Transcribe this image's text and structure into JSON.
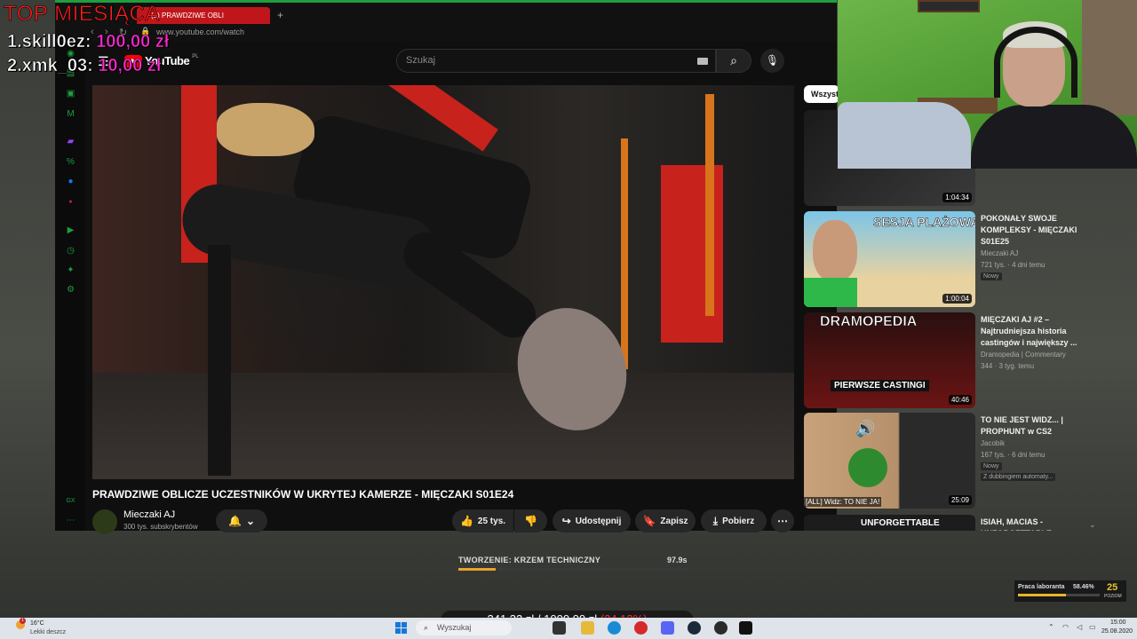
{
  "browser": {
    "tab_title": "(1) PRAWDZIWE OBLI",
    "new_tab": "+",
    "url": "www.youtube.com/watch",
    "accent": "#1e9e3e"
  },
  "youtube": {
    "logo_text": "YouTube",
    "region": "PL",
    "search_placeholder": "Szukaj",
    "search_icon": "search-icon",
    "mic_icon": "mic-icon"
  },
  "video": {
    "title": "PRAWDZIWE OBLICZE UCZESTNIKÓW W UKRYTEJ KAMERZE - MIĘCZAKI S01E24",
    "channel": "Mieczaki AJ",
    "subscribers": "300 tys. subskrybentów",
    "likes": "25 tys.",
    "share": "Udostępnij",
    "save": "Zapisz",
    "download": "Pobierz"
  },
  "recommendations": {
    "filter": "Wszystko",
    "items": [
      {
        "title": "",
        "channel": "",
        "views": "",
        "age": "",
        "duration": "1:04:34",
        "badge": ""
      },
      {
        "title": "POKONAŁY SWOJE KOMPLEKSY - MIĘCZAKI S01E25",
        "channel": "Mieczaki AJ",
        "views": "721 tys.",
        "age": "4 dni temu",
        "duration": "1:00:04",
        "badge": "Nowy",
        "thumb_text": "SESJA PLAŻOWA"
      },
      {
        "title": "MIĘCZAKI AJ #2 – Najtrudniejsza historia castingów i największy ...",
        "channel": "Dramopedia | Commentary",
        "views": "344",
        "age": "3 tyg. temu",
        "duration": "40:46",
        "badge": "",
        "thumb_text": "DRAMOPEDIA",
        "thumb_text2": "PIERWSZE CASTINGI"
      },
      {
        "title": "TO NIE JEST WIDZ... | PROPHUNT w CS2",
        "channel": "Jacobik",
        "views": "167 tys.",
        "age": "6 dni temu",
        "duration": "25:09",
        "badge": "Nowy",
        "badge2": "Z dubbingiem automaty...",
        "thumb_text": "[ALL] Widz: TO NIE JA!"
      },
      {
        "title": "ISIAH, MACIAS - UNFORGETTABLE",
        "channel": "",
        "views": "",
        "age": "",
        "duration": "",
        "badge": "",
        "thumb_text": "UNFORGETTABLE"
      }
    ]
  },
  "overlay": {
    "top_title": "TOP MIESIĄCA",
    "donors": [
      {
        "rank_name": "1.skill0ez:",
        "amount": "100,00 zł"
      },
      {
        "rank_name": "2.xmk_03:",
        "amount": "10,00 zł"
      }
    ],
    "progress_label": "TWORZENIE: KRZEM TECHNICZNY",
    "progress_time": "97.9s",
    "progress_fraction": 0.16,
    "lab_label": "Praca laboranta",
    "lab_pct": "58.46%",
    "lab_fraction": 0.5846,
    "lab_level": "25",
    "lab_level_label": "POZIOM",
    "donation_current": "241,32 zł",
    "donation_sep": "/",
    "donation_goal": "1000,00 zł",
    "donation_pct": "(24,13%)",
    "colors": {
      "donor_amount": "#ff2bd0",
      "top_title": "#ff1d1d",
      "progress": "#e7a22c"
    }
  },
  "taskbar": {
    "temp": "16°C",
    "weather": "Lekki deszcz",
    "notification_count": "1",
    "search": "Wyszukaj",
    "time": "15:00",
    "date": "25.08.2020"
  }
}
